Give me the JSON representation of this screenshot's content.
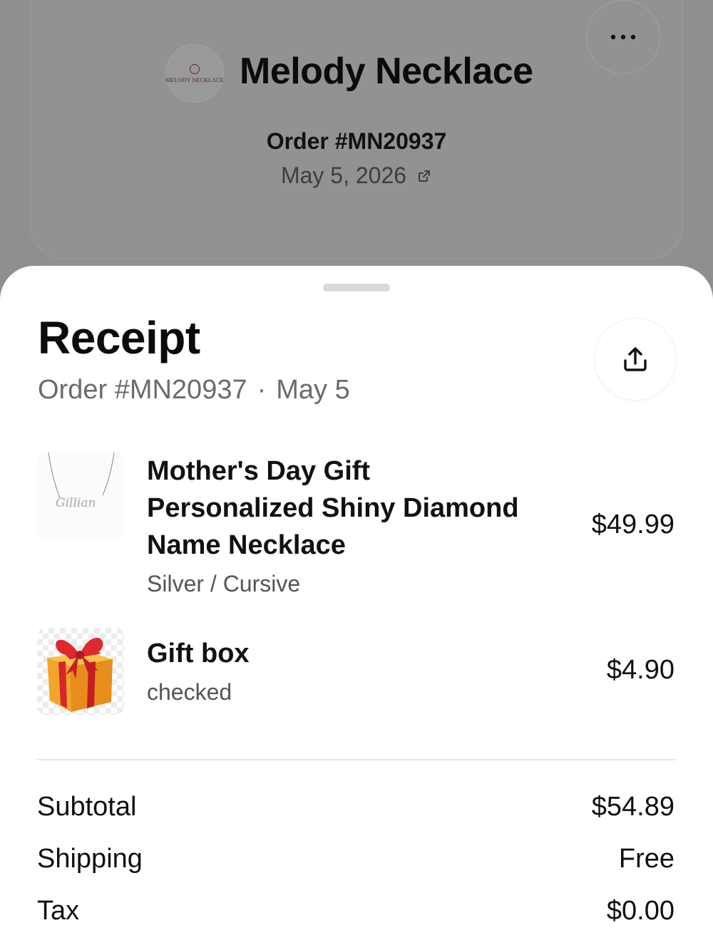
{
  "store": {
    "name": "Melody Necklace",
    "logo_text": "MELODY NECKLACE",
    "order_title": "Order #MN20937",
    "order_date": "May 5, 2026"
  },
  "receipt": {
    "title": "Receipt",
    "order_ref": "Order #MN20937",
    "separator": "·",
    "date_short": "May 5"
  },
  "items": [
    {
      "name_lines": [
        "Mother's Day Gift",
        "Personalized Shiny Diamond",
        "Name Necklace"
      ],
      "variant": "Silver / Cursive",
      "price": "$49.99",
      "engraving": "Gillian"
    },
    {
      "name_lines": [
        "Gift box"
      ],
      "variant": "checked",
      "price": "$4.90"
    }
  ],
  "summary": {
    "subtotal_label": "Subtotal",
    "subtotal_value": "$54.89",
    "shipping_label": "Shipping",
    "shipping_value": "Free",
    "tax_label": "Tax",
    "tax_value": "$0.00"
  },
  "icons": {
    "more": "more-horizontal-icon",
    "external": "external-link-icon",
    "share": "share-icon"
  },
  "colors": {
    "overlay": "#8f8f8f",
    "sheet": "#ffffff",
    "muted_text": "#6b6b6b",
    "logo_text": "#5a1e1e",
    "ribbon": "#d8262b",
    "box": "#f2a52a"
  }
}
